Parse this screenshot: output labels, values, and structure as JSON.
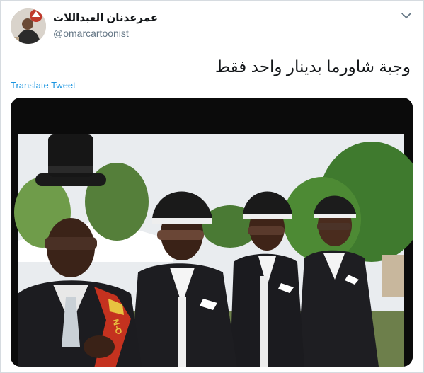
{
  "tweet": {
    "display_name": "عمرعدنان العبداللات",
    "handle": "@omarcartoonist",
    "text": "وجبة شاورما بدينار واحد فقط",
    "translate_label": "Translate Tweet",
    "menu_icon": "chevron-down-icon"
  },
  "media": {
    "kind": "video-still",
    "subject": "four pallbearers in black suits, peaked caps and sunglasses",
    "sash_text": "N-O"
  }
}
